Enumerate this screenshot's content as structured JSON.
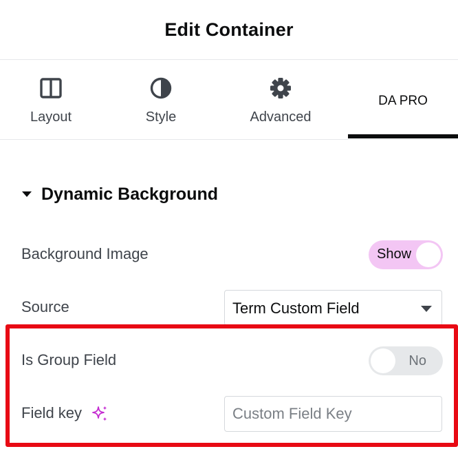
{
  "header": {
    "title": "Edit Container"
  },
  "tabs": [
    {
      "label": "Layout",
      "icon": "layout-columns-icon"
    },
    {
      "label": "Style",
      "icon": "half-circle-contrast-icon"
    },
    {
      "label": "Advanced",
      "icon": "gear-icon"
    },
    {
      "label": "DA PRO",
      "active": true
    }
  ],
  "section": {
    "title": "Dynamic Background",
    "icon": "caret-down-icon",
    "rows": {
      "background_image": {
        "label": "Background Image",
        "toggle_text": "Show",
        "enabled": true
      },
      "source": {
        "label": "Source",
        "selected": "Term Custom Field"
      },
      "is_group_field": {
        "label": "Is Group Field",
        "toggle_text": "No",
        "enabled": false
      },
      "field_key": {
        "label": "Field key",
        "icon": "ai-sparkle-icon",
        "value": "",
        "placeholder": "Custom Field Key"
      }
    }
  },
  "colors": {
    "accent_pink": "#f3c6f4",
    "sparkle_magenta": "#c42ad1",
    "highlight_red": "#e80a14",
    "active_tab_bar": "#0c0d0e"
  }
}
